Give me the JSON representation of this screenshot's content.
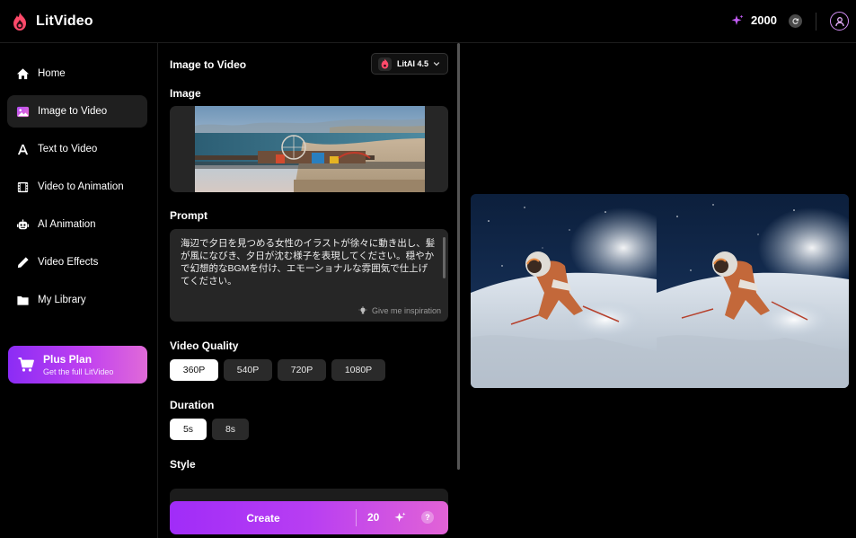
{
  "app": {
    "name": "LitVideo"
  },
  "header": {
    "credits": "2000"
  },
  "sidebar": {
    "items": [
      {
        "label": "Home",
        "icon": "home-icon"
      },
      {
        "label": "Image to Video",
        "icon": "image-icon",
        "active": true
      },
      {
        "label": "Text to Video",
        "icon": "text-icon"
      },
      {
        "label": "Video to Animation",
        "icon": "film-icon"
      },
      {
        "label": "AI Animation",
        "icon": "robot-icon"
      },
      {
        "label": "Video Effects",
        "icon": "pen-icon"
      },
      {
        "label": "My Library",
        "icon": "folder-icon"
      }
    ],
    "plan": {
      "title": "Plus Plan",
      "subtitle": "Get the full LitVideo"
    }
  },
  "panel": {
    "title": "Image to Video",
    "model": "LitAI 4.5",
    "image_label": "Image",
    "prompt_label": "Prompt",
    "prompt_text": "海辺で夕日を見つめる女性のイラストが徐々に動き出し、髪が風になびき、夕日が沈む様子を表現してください。穏やかで幻想的なBGMを付け、エモーショナルな雰囲気で仕上げてください。",
    "inspiration": "Give me inspiration",
    "quality_label": "Video Quality",
    "quality_options": [
      "360P",
      "540P",
      "720P",
      "1080P"
    ],
    "quality_selected": "360P",
    "duration_label": "Duration",
    "duration_options": [
      "5s",
      "8s"
    ],
    "duration_selected": "5s",
    "style_label": "Style",
    "create_label": "Create",
    "create_cost": "20",
    "help": "?"
  },
  "colors": {
    "accent_gradient_start": "#a02cf8",
    "accent_gradient_end": "#e263d6",
    "background": "#000000",
    "card": "#262626"
  }
}
